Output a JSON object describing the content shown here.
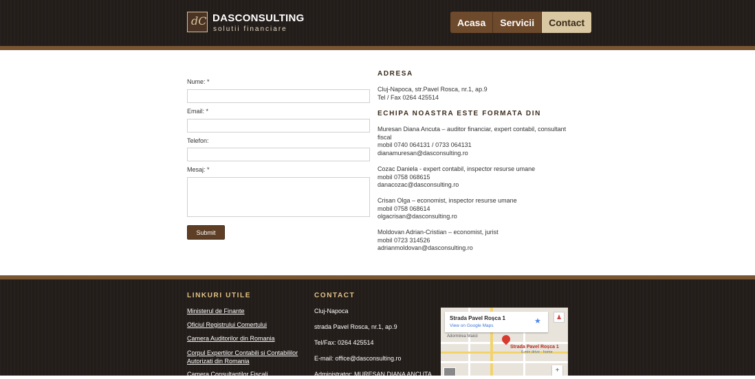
{
  "header": {
    "logo_mark": "dC",
    "logo_title": "DASCONSULTING",
    "logo_subtitle": "solutii financiare",
    "nav": [
      {
        "label": "Acasa",
        "active": false
      },
      {
        "label": "Servicii",
        "active": false
      },
      {
        "label": "Contact",
        "active": true
      }
    ]
  },
  "form": {
    "name_label": "Nume: *",
    "email_label": "Email: *",
    "phone_label": "Telefon:",
    "message_label": "Mesaj: *",
    "submit_label": "Submit"
  },
  "address": {
    "title": "ADRESA",
    "line1": "Cluj-Napoca, str.Pavel Rosca, nr.1, ap.9",
    "line2": "Tel / Fax 0264 425514"
  },
  "team": {
    "title": "ECHIPA NOASTRA ESTE FORMATA DIN",
    "members": [
      {
        "role": "Muresan Diana Ancuta – auditor financiar, expert contabil, consultant fiscal",
        "phone": "mobil 0740 064131 / 0733 064131",
        "email": "dianamuresan@dasconsulting.ro"
      },
      {
        "role": "Cozac Daniela - expert contabil, inspector resurse umane",
        "phone": "mobil 0758 068615",
        "email": "danacozac@dasconsulting.ro"
      },
      {
        "role": "Crisan Olga – economist, inspector resurse umane",
        "phone": "mobil 0758 068614",
        "email": "olgacrisan@dasconsulting.ro"
      },
      {
        "role": "Moldovan Adrian-Cristian – economist, jurist",
        "phone": "mobil 0723 314526",
        "email": "adrianmoldovan@dasconsulting.ro"
      }
    ]
  },
  "footer": {
    "links_title": "LINKURI UTILE",
    "links": [
      "Ministerul de Finante",
      "Oficiul Registrului Comertului",
      "Camera Auditorilor din Romania",
      "Corpul Expertilor Contabili si Contabililor Autorizati din Romania",
      "Camera Consultantilor Fiscali"
    ],
    "contact_title": "CONTACT",
    "contact_lines": [
      "Cluj-Napoca",
      "strada Pavel Rosca, nr.1, ap.9",
      "Tel/Fax: 0264 425514",
      "E-mail: office@dasconsulting.ro",
      "Administrator: MURESAN DIANA ANCUTA"
    ],
    "map": {
      "place_title": "Strada Pavel Roșca 1",
      "view_link": "View on Google Maps",
      "pin_label": "Strada Pavel Roșca 1",
      "pin_sub": "6 min drive - home",
      "street_label": "Adormirea Maicii"
    }
  }
}
